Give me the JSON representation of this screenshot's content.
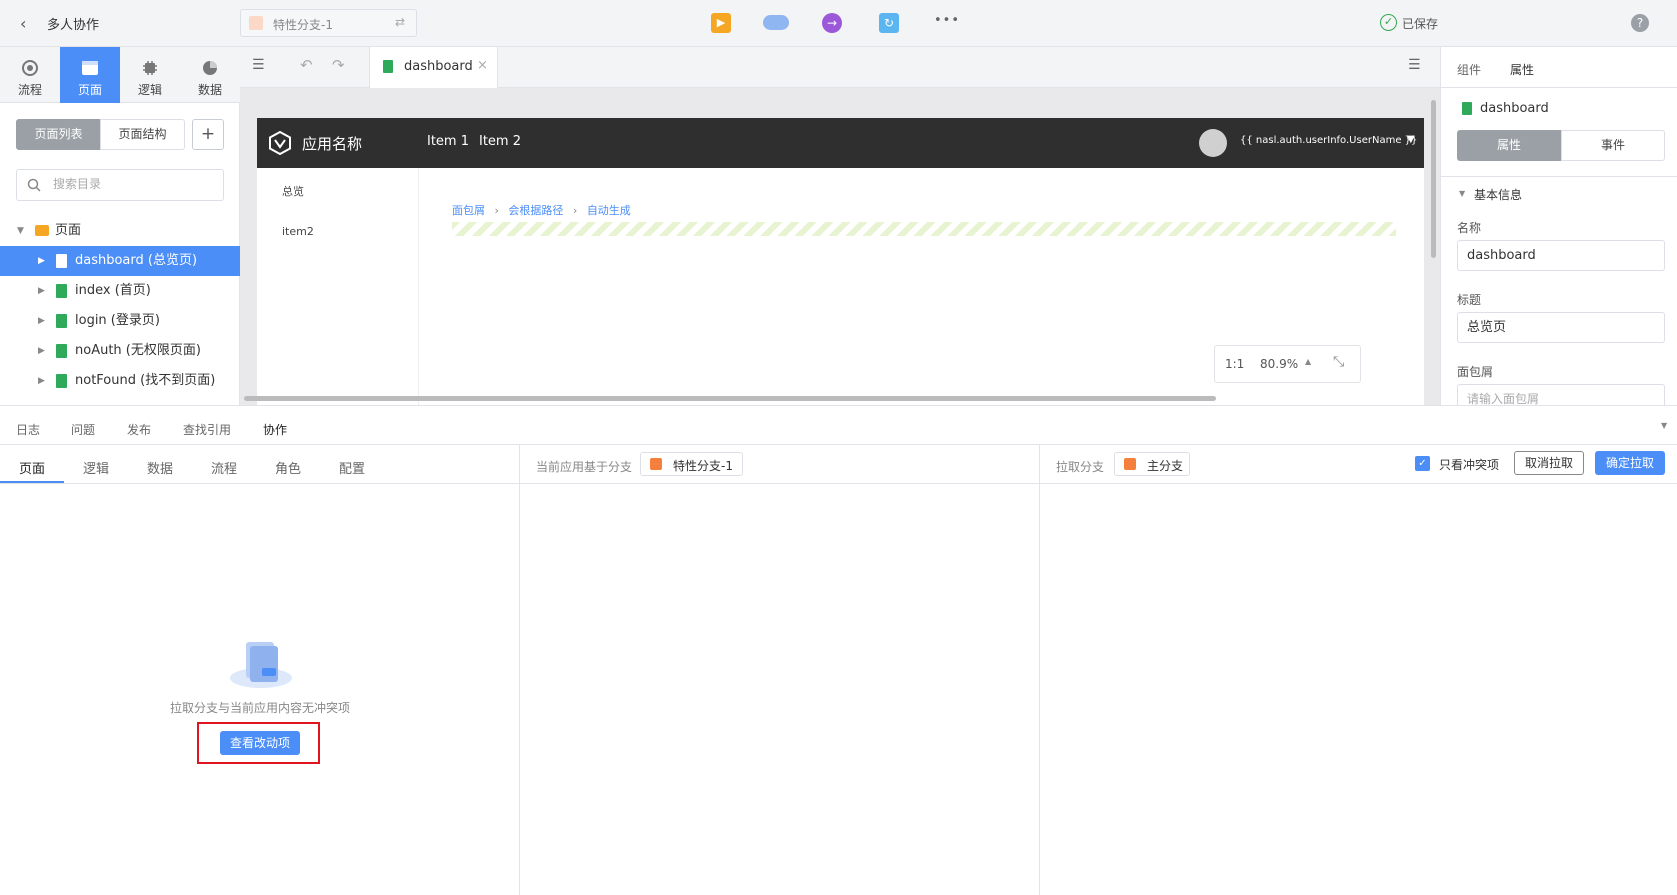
{
  "topbar": {
    "back_title": "多人协作",
    "branch": "特性分支-1",
    "saved": "已保存",
    "more": "•••"
  },
  "leftnav": {
    "tabs": [
      {
        "label": "流程",
        "icon": "process-icon"
      },
      {
        "label": "页面",
        "icon": "page-icon"
      },
      {
        "label": "逻辑",
        "icon": "logic-icon"
      },
      {
        "label": "数据",
        "icon": "data-icon"
      }
    ],
    "active_index": 1
  },
  "leftpanel": {
    "toggle": [
      "页面列表",
      "页面结构"
    ],
    "add": "+",
    "search_placeholder": "搜索目录",
    "root": "页面",
    "pages": [
      "dashboard (总览页)",
      "index (首页)",
      "login (登录页)",
      "noAuth (无权限页面)",
      "notFound (找不到页面)"
    ],
    "selected_index": 0
  },
  "editor": {
    "tab": "dashboard",
    "close": "×"
  },
  "preview": {
    "app_name": "应用名称",
    "menu": [
      "Item 1",
      "Item 2"
    ],
    "user": "{{ nasl.auth.userInfo.UserName }}",
    "side": [
      "总览",
      "item2"
    ],
    "breadcrumb": [
      "面包屑",
      "会根据路径",
      "自动生成"
    ],
    "zoom_one": "1:1",
    "zoom": "80.9%"
  },
  "rightpanel": {
    "tabs": [
      "组件",
      "属性"
    ],
    "page_name": "dashboard",
    "toggle": [
      "属性",
      "事件"
    ],
    "section": "基本信息",
    "name_label": "名称",
    "name_value": "dashboard",
    "title_label": "标题",
    "title_value": "总览页",
    "crumb_label": "面包屑",
    "crumb_placeholder": "请输入面包屑"
  },
  "bottom": {
    "tabs": [
      "日志",
      "问题",
      "发布",
      "查找引用",
      "协作"
    ],
    "active_tab": 4,
    "subtabs": [
      "页面",
      "逻辑",
      "数据",
      "流程",
      "角色",
      "配置"
    ],
    "base_label": "当前应用基于分支",
    "base_branch": "特性分支-1",
    "pull_label": "拉取分支",
    "pull_branch": "主分支",
    "only_conflicts": "只看冲突项",
    "cancel": "取消拉取",
    "confirm": "确定拉取",
    "empty_text": "拉取分支与当前应用内容无冲突项",
    "view_changes": "查看改动项"
  },
  "colors": {
    "accent": "#4b8ef7",
    "highlight_border": "#e0141e",
    "branch_orange": "#f57f3c",
    "page_green": "#2faa5a"
  }
}
